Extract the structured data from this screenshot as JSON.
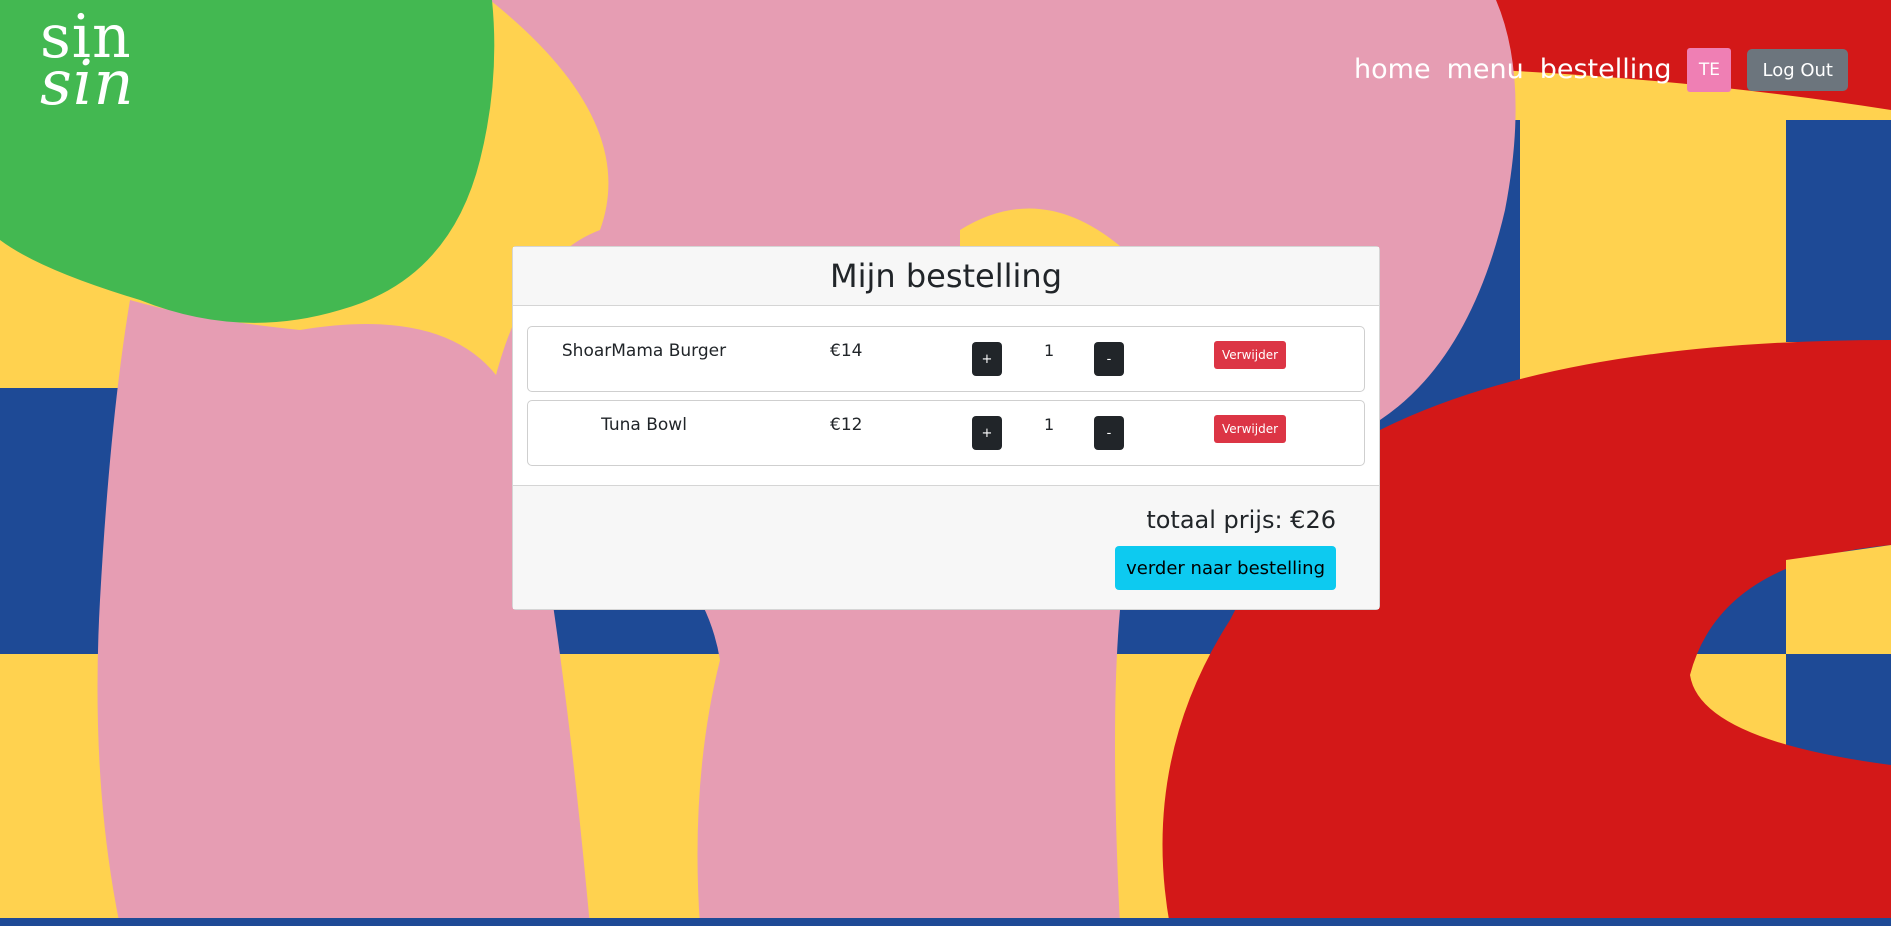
{
  "brand": {
    "line1": "sin",
    "line2": "sin"
  },
  "nav": {
    "home": "home",
    "menu": "menu",
    "bestelling": "bestelling",
    "avatar": "TE",
    "logout": "Log Out"
  },
  "order": {
    "title": "Mijn bestelling",
    "items": [
      {
        "name": "ShoarMama Burger",
        "price": "€14",
        "qty": "1",
        "plus": "+",
        "minus": "-",
        "remove": "Verwijder"
      },
      {
        "name": "Tuna Bowl",
        "price": "€12",
        "qty": "1",
        "plus": "+",
        "minus": "-",
        "remove": "Verwijder"
      }
    ],
    "total": "totaal prijs: €26",
    "checkout": "verder naar bestelling"
  },
  "colors": {
    "yellow": "#ffd24f",
    "blue": "#1e4a96",
    "pink": "#e69db3",
    "green": "#43b851",
    "red": "#d31818",
    "checkout": "#0dcaf0",
    "remove": "#dc3545",
    "avatar": "#ef7fb4"
  }
}
